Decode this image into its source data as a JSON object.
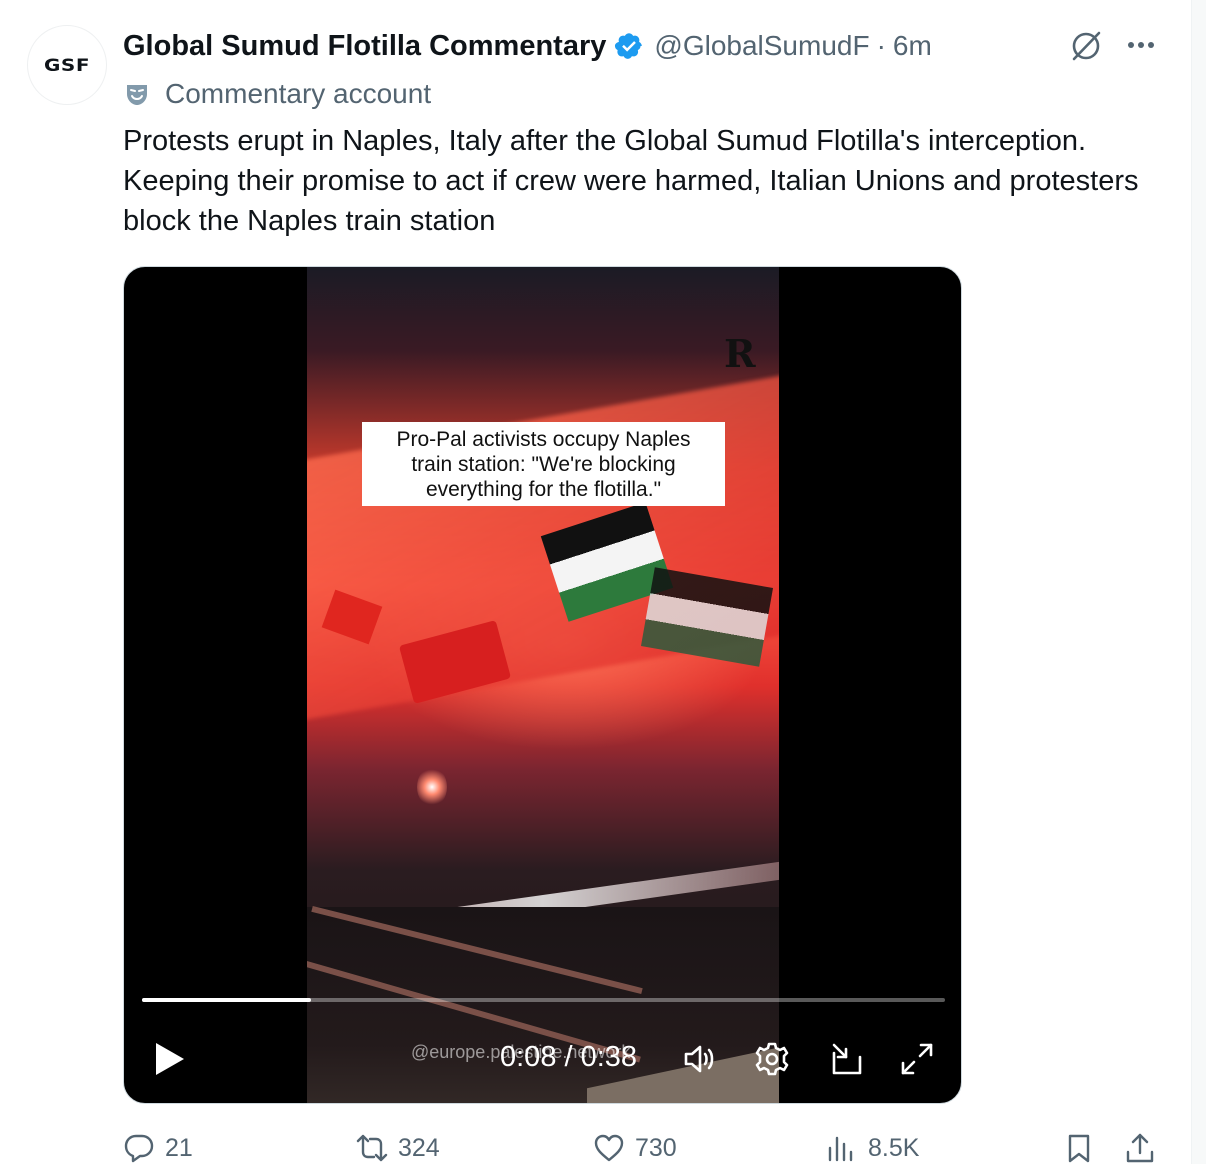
{
  "post": {
    "avatar_text": "GSF",
    "display_name": "Global Sumud Flotilla Commentary",
    "handle": "@GlobalSumudF",
    "separator": "·",
    "time": "6m",
    "label": "Commentary account",
    "text": "Protests erupt in Naples, Italy after the Global Sumud Flotilla's interception. Keeping their promise to act if crew were harmed, Italian Unions and protesters block the Naples train station"
  },
  "media": {
    "overlay_logo": "R",
    "caption_lines": [
      "Pro-Pal activists occupy Naples",
      "train station: \"We're blocking",
      "everything for the flotilla.\""
    ],
    "watermark": "@europe.palestine.network",
    "current_time": "0:08",
    "duration": "0:38",
    "time_display": "0:08 / 0:38",
    "progress_fraction": 0.21
  },
  "actions": {
    "replies": "21",
    "reposts": "324",
    "likes": "730",
    "views": "8.5K"
  },
  "colors": {
    "verified_badge": "#1d9bf0",
    "secondary_text": "#536471",
    "primary_text": "#0f1419"
  },
  "icons": [
    "verified-badge-icon",
    "grok-icon",
    "more-icon",
    "commentary-mask-icon",
    "play-icon",
    "volume-icon",
    "settings-icon",
    "pip-icon",
    "fullscreen-icon",
    "reply-icon",
    "repost-icon",
    "like-icon",
    "views-icon",
    "bookmark-icon",
    "share-icon"
  ]
}
